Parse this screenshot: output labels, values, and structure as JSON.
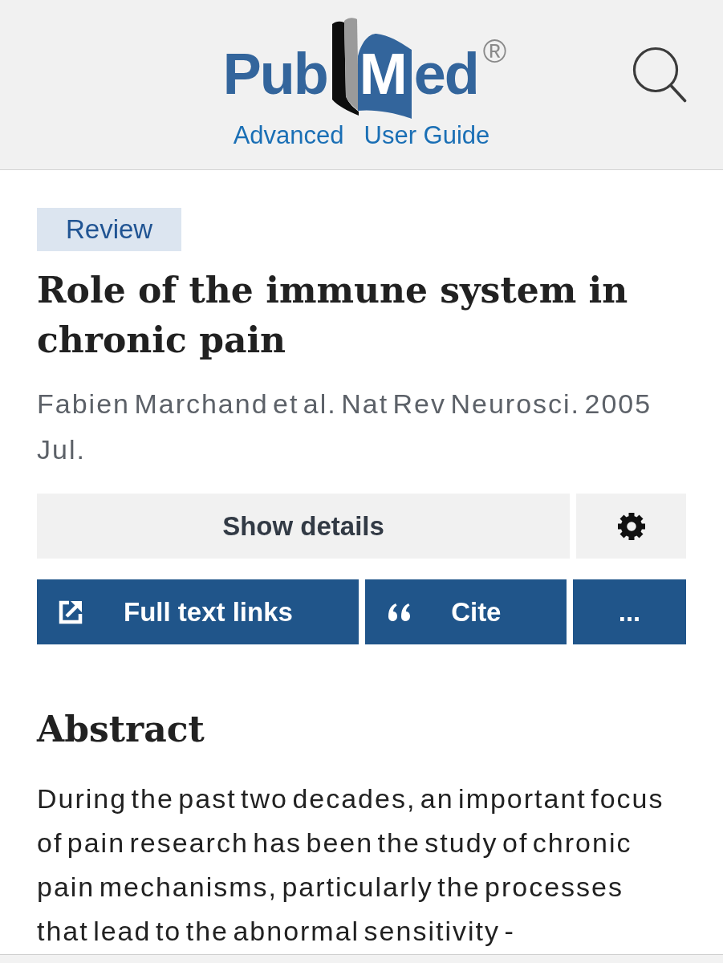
{
  "header": {
    "logo": {
      "parts": [
        "Pub",
        "Med"
      ],
      "mark": "®"
    },
    "links": [
      "Advanced",
      "User Guide"
    ]
  },
  "article": {
    "badge": "Review",
    "title": "Role of the immune system in chronic pain",
    "citation": "Fabien Marchand et al. Nat Rev Neurosci. 2005 Jul."
  },
  "actions": {
    "details": "Show details",
    "buttons": [
      {
        "kind": "external",
        "label": "Full text links"
      },
      {
        "kind": "quote",
        "label": "Cite"
      },
      {
        "kind": "more",
        "label": "..."
      }
    ]
  },
  "abstract": {
    "heading": "Abstract",
    "text": "During the past two decades, an important focus of pain research has been the study of chronic pain mechanisms, particularly the processes that lead to the abnormal sensitivity -"
  }
}
